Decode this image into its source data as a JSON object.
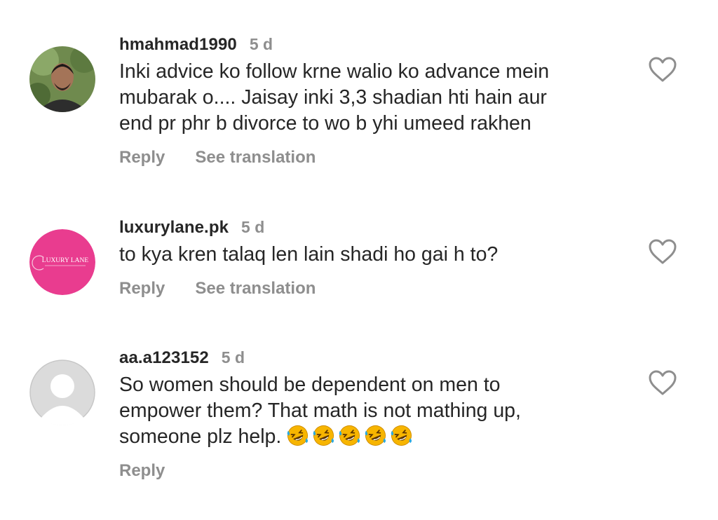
{
  "comments": [
    {
      "username": "hmahmad1990",
      "time": "5 d",
      "text": "Inki advice ko follow krne walio ko advance mein\nmubarak o.... Jaisay inki 3,3 shadian hti hain aur\nend pr phr b divorce to wo b yhi umeed rakhen",
      "reply_label": "Reply",
      "translation_label": "See translation",
      "avatar_icon": "user-photo"
    },
    {
      "username": "luxurylane.pk",
      "time": "5 d",
      "text": "to kya kren talaq len lain shadi ho gai h to?",
      "reply_label": "Reply",
      "translation_label": "See translation",
      "avatar_icon": "brand-logo",
      "avatar_logo_text": "LUXURY LANE",
      "avatar_color": "#e93c8f"
    },
    {
      "username": "aa.a123152",
      "time": "5 d",
      "text": "So women should be dependent on men to\nempower them? That math is not mathing up,\nsomeone plz help. ",
      "emoji": [
        "🤣",
        "🤣",
        "🤣",
        "🤣",
        "🤣"
      ],
      "emoji_icon": "rolling-on-floor-laughing",
      "reply_label": "Reply",
      "avatar_icon": "default-avatar"
    }
  ],
  "like_icon": "heart-outline",
  "colors": {
    "text": "#262626",
    "muted": "#8e8e8e",
    "emoji_face": "#f7b500",
    "emoji_tear": "#2aa8e0"
  }
}
